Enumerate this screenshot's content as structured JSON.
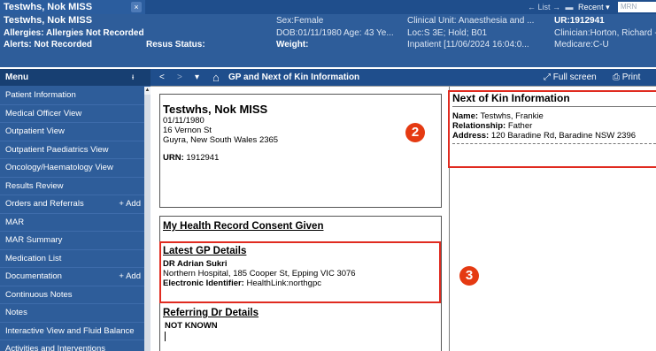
{
  "tab": {
    "title": "Testwhs, Nok  MISS",
    "close": "×"
  },
  "nav": {
    "list": "← List →",
    "recent": "Recent ▾",
    "mrn_placeholder": "MRN"
  },
  "banner": {
    "name": "Testwhs, Nok  MISS",
    "allergies": "Allergies: Allergies Not Recorded",
    "alerts": "Alerts: Not Recorded",
    "resus": "Resus Status:",
    "sex": "Sex:Female",
    "dob_age": "DOB:01/11/1980   Age: 43 Ye...",
    "weight": "Weight:",
    "clinical_unit": "Clinical Unit: Anaesthesia and ...",
    "loc": "Loc:S 3E; Hold; B01",
    "inpatient": "Inpatient [11/06/2024 16:04:0...",
    "ur": "UR:1912941",
    "clinician": "Clinician:Horton, Richard  -",
    "medicare": "Medicare:C-U"
  },
  "sidebar": {
    "header": "Menu",
    "pin": "ᵻ",
    "items": [
      {
        "label": "Patient Information"
      },
      {
        "label": "Medical Officer View"
      },
      {
        "label": "Outpatient View"
      },
      {
        "label": "Outpatient Paediatrics View"
      },
      {
        "label": "Oncology/Haematology View"
      },
      {
        "label": "Results Review"
      },
      {
        "label": "Orders and Referrals",
        "add": "+ Add"
      },
      {
        "label": "MAR"
      },
      {
        "label": "MAR Summary"
      },
      {
        "label": "Medication List"
      },
      {
        "label": "Documentation",
        "add": "+ Add"
      },
      {
        "label": "Continuous Notes"
      },
      {
        "label": "Notes"
      },
      {
        "label": "Interactive View and Fluid Balance"
      },
      {
        "label": "Activities and Interventions"
      }
    ]
  },
  "toolbar": {
    "back": "<",
    "forward": ">",
    "dropdown": "▾",
    "home": "⌂",
    "page_title": "GP and Next of Kin Information",
    "fullscreen": "Full screen",
    "print": "Print"
  },
  "patient_card": {
    "name": "Testwhs, Nok   MISS",
    "dob": "01/11/1980",
    "street": "16 Vernon St",
    "city": "Guyra, New South Wales 2365",
    "urn_label": "URN:",
    "urn": "1912941"
  },
  "consent": {
    "heading": "My Health Record Consent Given"
  },
  "gp": {
    "heading": "Latest GP Details",
    "doctor": "DR Adrian Sukri",
    "address": "Northern Hospital, 185 Cooper St, Epping  VIC  3076",
    "eid_label": "Electronic Identifier:",
    "eid": "HealthLink:northgpc"
  },
  "referring": {
    "heading": "Referring Dr Details",
    "value": "NOT KNOWN"
  },
  "nok": {
    "heading": "Next of Kin Information",
    "name_label": "Name:",
    "name": "Testwhs, Frankie",
    "rel_label": "Relationship:",
    "relationship": "Father",
    "addr_label": "Address:",
    "address": "120 Baradine Rd, Baradine NSW 2396"
  },
  "markers": {
    "two": "2",
    "three": "3"
  },
  "colors": {
    "banner": "#2e5d9a",
    "toolbar": "#1f4e8c",
    "highlight": "#e02b20",
    "marker": "#e53a12"
  },
  "icons": [
    "close-icon",
    "arrow-left-icon",
    "arrow-right-icon",
    "folder-icon",
    "pin-icon",
    "home-icon",
    "fullscreen-icon",
    "printer-icon",
    "plus-icon"
  ]
}
